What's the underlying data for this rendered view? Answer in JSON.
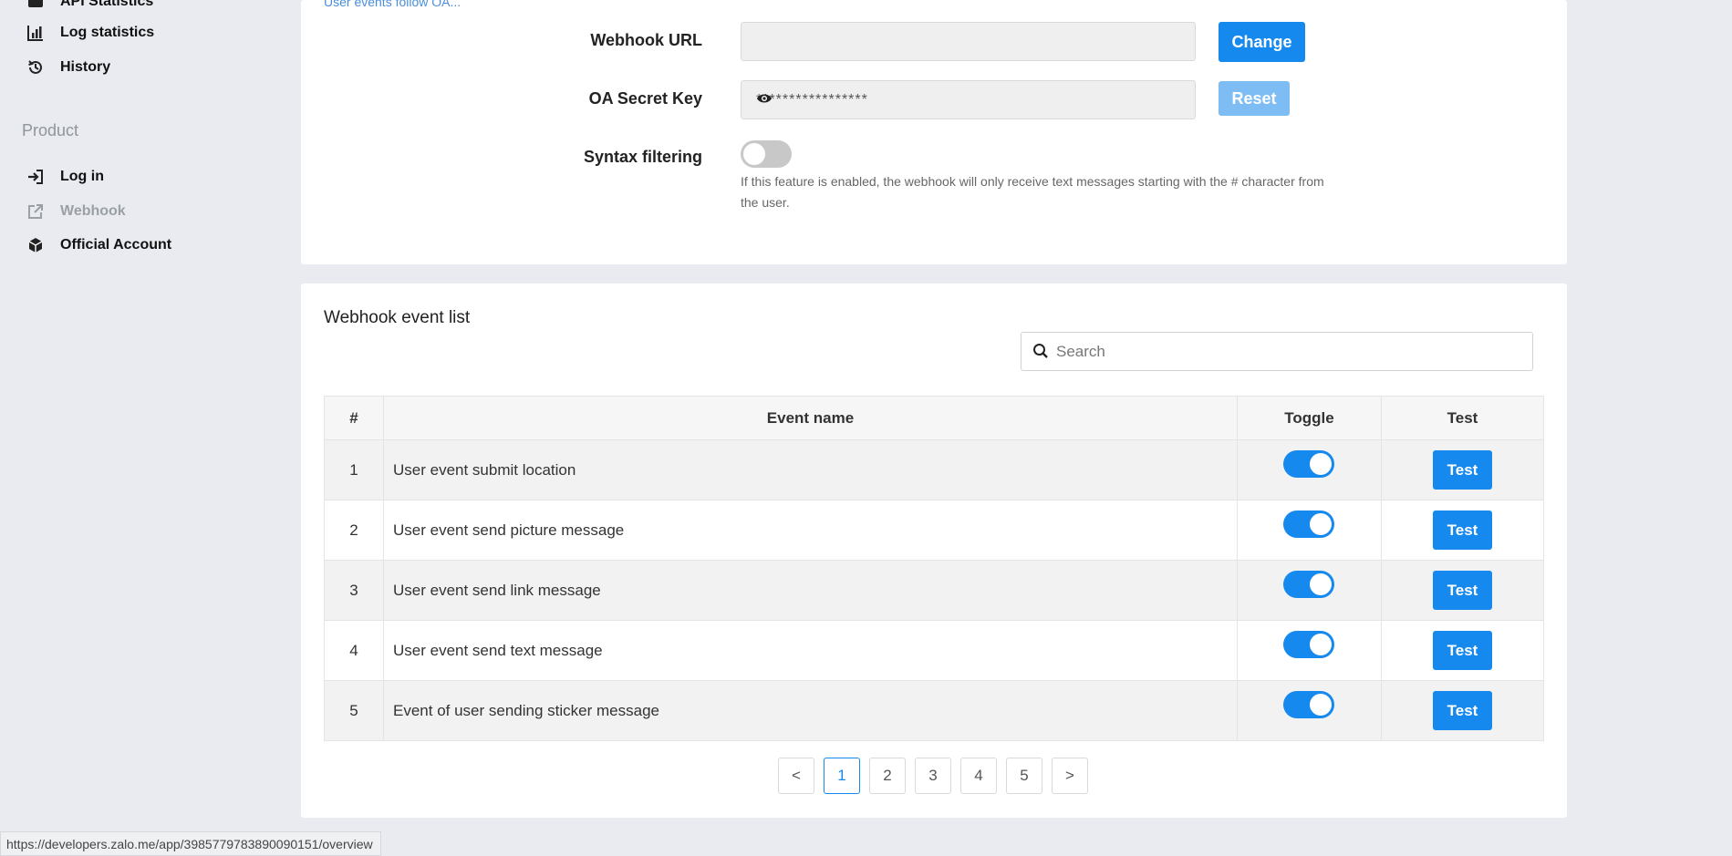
{
  "sidebar": {
    "items_top": [
      {
        "label": "API Statistics",
        "icon": "api-statistics-icon"
      },
      {
        "label": "Log statistics",
        "icon": "bar-chart-icon"
      },
      {
        "label": "History",
        "icon": "history-icon"
      }
    ],
    "section_label": "Product",
    "items_product": [
      {
        "label": "Log in",
        "icon": "login-icon"
      },
      {
        "label": "Webhook",
        "icon": "external-link-icon"
      },
      {
        "label": "Official Account",
        "icon": "cube-icon"
      }
    ]
  },
  "settings": {
    "top_link": "User events follow OA...",
    "webhook_url_label": "Webhook URL",
    "webhook_url_value": "",
    "change_label": "Change",
    "secret_key_label": "OA Secret Key",
    "secret_key_value": "*****************",
    "reset_label": "Reset",
    "syntax_filter_label": "Syntax filtering",
    "syntax_filter_enabled": false,
    "syntax_filter_help": "If this feature is enabled, the webhook will only receive text messages starting with the # character from the user."
  },
  "events": {
    "title": "Webhook event list",
    "search_placeholder": "Search",
    "columns": [
      "#",
      "Event name",
      "Toggle",
      "Test"
    ],
    "rows": [
      {
        "num": "1",
        "name": "User event submit location",
        "enabled": true,
        "test": "Test"
      },
      {
        "num": "2",
        "name": "User event send picture message",
        "enabled": true,
        "test": "Test"
      },
      {
        "num": "3",
        "name": "User event send link message",
        "enabled": true,
        "test": "Test"
      },
      {
        "num": "4",
        "name": "User event send text message",
        "enabled": true,
        "test": "Test"
      },
      {
        "num": "5",
        "name": "Event of user sending sticker message",
        "enabled": true,
        "test": "Test"
      }
    ],
    "pagination": {
      "prev": "<",
      "pages": [
        "1",
        "2",
        "3",
        "4",
        "5"
      ],
      "current": "1",
      "next": ">"
    }
  },
  "status_bar": "https://developers.zalo.me/app/3985779783890090151/overview",
  "colors": {
    "accent": "#1589ee",
    "accent_light": "#7ebdf4",
    "background": "#e9ebf0"
  }
}
